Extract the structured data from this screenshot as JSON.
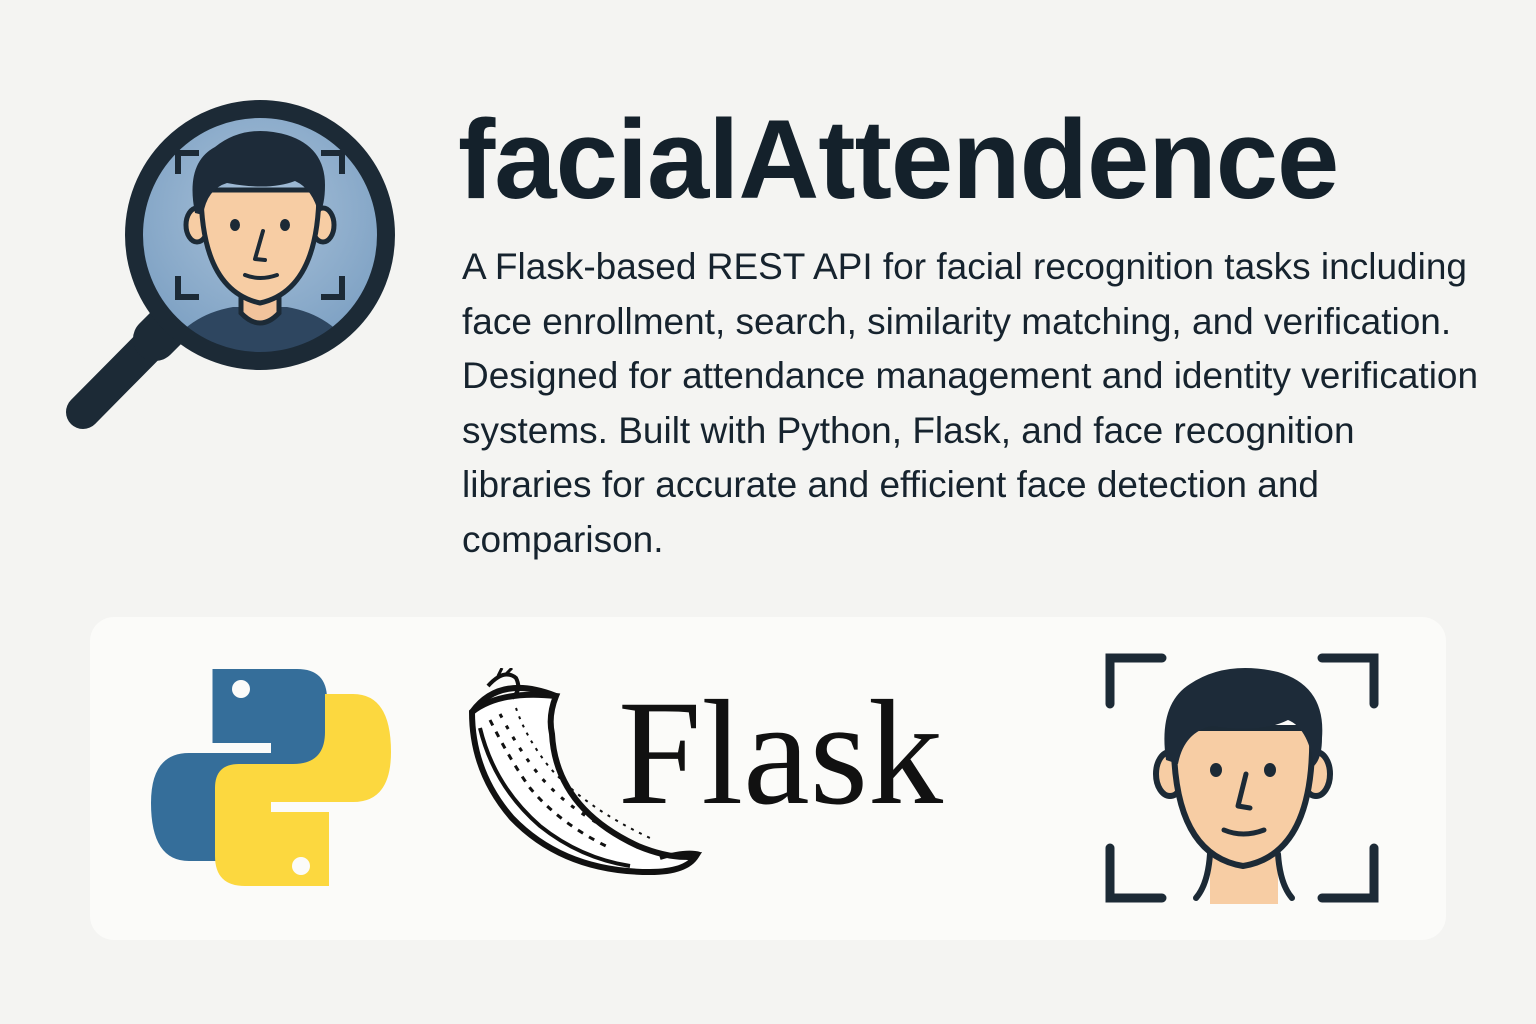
{
  "header": {
    "title": "facialAttendence",
    "description": "A Flask-based REST API for facial recognition tasks including face enrollment, search, similarity matching, and verification. Designed for attendance management and identity verification systems. Built with Python, Flask, and face recognition libraries for accurate and efficient face detection and comparison."
  },
  "icons": {
    "hero": "magnifier-face-icon",
    "python": "python-logo",
    "flask": "flask-horn-icon",
    "face": "face-scan-icon"
  },
  "tech_logos": {
    "flask_label": "Flask"
  },
  "colors": {
    "background": "#f4f4f2",
    "panel": "#fbfbf9",
    "ink": "#14212b",
    "python_blue": "#356e9a",
    "python_yellow": "#fcd83f",
    "skin": "#f7cda4",
    "hair": "#1d2b39",
    "lens": "#8aaccc",
    "shirt": "#2e4660"
  }
}
